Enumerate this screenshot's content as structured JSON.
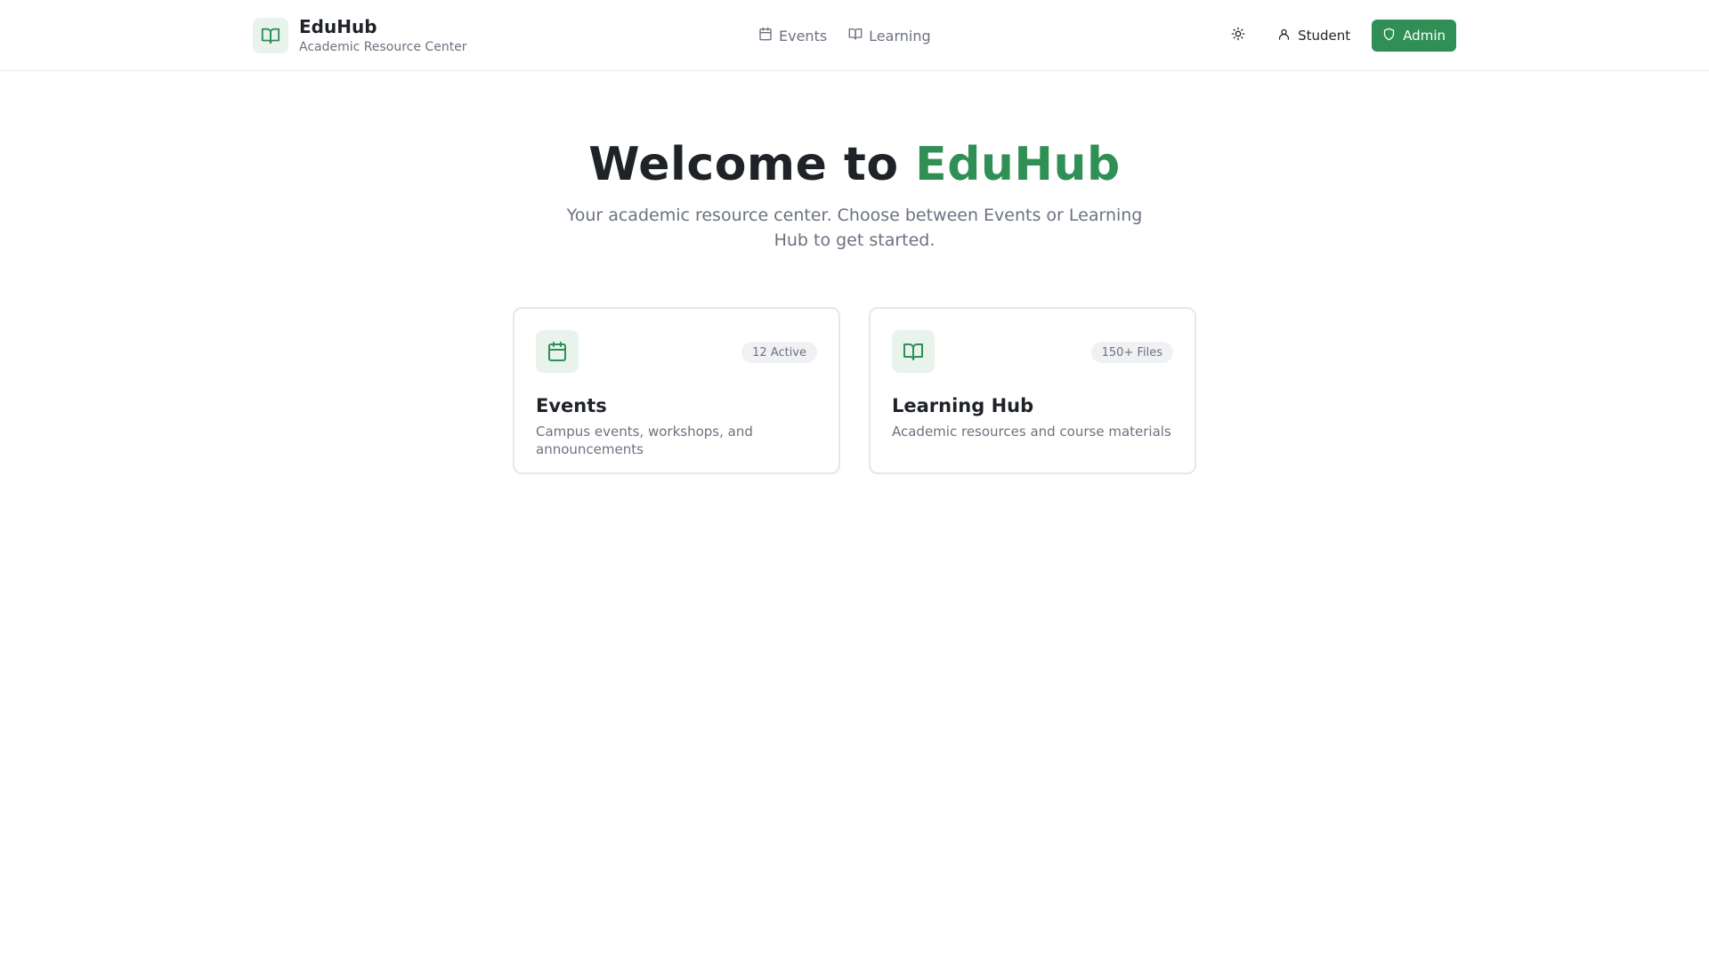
{
  "brand": {
    "name": "EduHub",
    "subtitle": "Academic Resource Center",
    "icon": "book-open-icon"
  },
  "nav": {
    "items": [
      {
        "label": "Events",
        "icon": "calendar-icon"
      },
      {
        "label": "Learning",
        "icon": "book-open-icon"
      }
    ]
  },
  "actions": {
    "theme_icon": "sun-icon",
    "student_label": "Student",
    "admin_label": "Admin"
  },
  "hero": {
    "title_prefix": "Welcome to ",
    "title_accent": "EduHub",
    "subtitle": "Your academic resource center. Choose between Events or Learning Hub to get started."
  },
  "cards": [
    {
      "icon": "calendar-icon",
      "badge": "12 Active",
      "title": "Events",
      "description": "Campus events, workshops, and announcements"
    },
    {
      "icon": "book-open-icon",
      "badge": "150+ Files",
      "title": "Learning Hub",
      "description": "Academic resources and course materials"
    }
  ],
  "colors": {
    "accent": "#2f8f55",
    "accent_light": "#e8f3ec",
    "text": "#1f2328",
    "muted": "#6b7280",
    "border": "#e5e7eb"
  }
}
